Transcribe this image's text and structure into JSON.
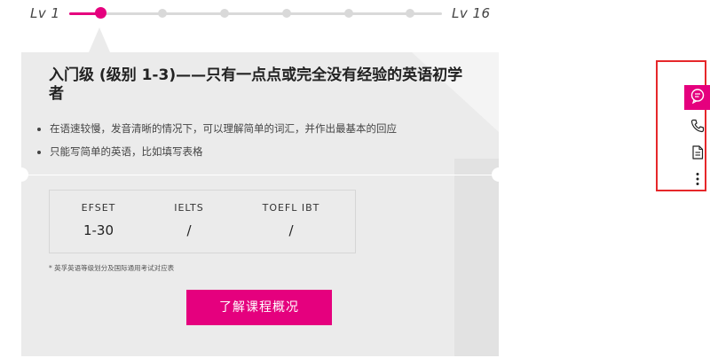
{
  "level_slider": {
    "min_label": "Lv 1",
    "max_label": "Lv 16",
    "current_step": 1,
    "total_steps": 7,
    "accent_color": "#e5007e"
  },
  "level_card": {
    "title": "入门级 (级别 1-3)——只有一点点或完全没有经验的英语初学者",
    "bullets": [
      "在语速较慢，发音清晰的情况下，可以理解简单的词汇，并作出最基本的回应",
      "只能写简单的英语，比如填写表格"
    ],
    "scores": [
      {
        "header": "EFSET",
        "value": "1-30"
      },
      {
        "header": "IELTS",
        "value": "/"
      },
      {
        "header": "TOEFL IBT",
        "value": "/"
      }
    ],
    "note": "* 英孚英语等级划分及国际通用考试对应表",
    "cta_label": "了解课程概况"
  },
  "side_toolbar": {
    "items": [
      {
        "icon": "chat-icon",
        "active": true
      },
      {
        "icon": "phone-icon",
        "active": false
      },
      {
        "icon": "document-icon",
        "active": false
      },
      {
        "icon": "more-icon",
        "active": false
      }
    ]
  }
}
